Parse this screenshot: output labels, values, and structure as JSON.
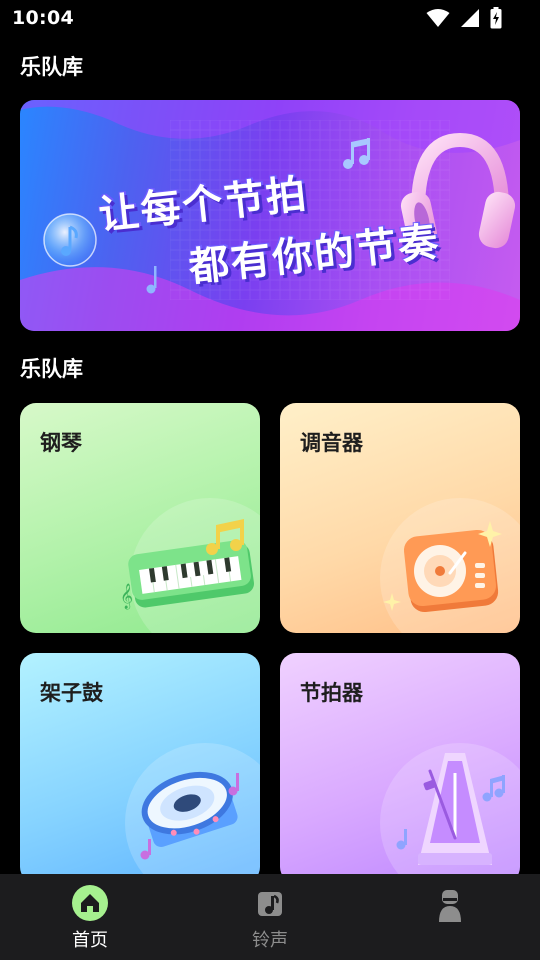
{
  "status_bar": {
    "time": "10:04",
    "icons": [
      "wifi-icon",
      "signal-icon",
      "battery-charging-icon"
    ]
  },
  "header": {
    "title": "乐队库"
  },
  "banner": {
    "line1": "让每个节拍",
    "line2": "都有你的节奏",
    "decorations": [
      "music-note-icon",
      "headphones-icon"
    ]
  },
  "section": {
    "title": "乐队库"
  },
  "cards": [
    {
      "label": "钢琴",
      "icon": "piano-icon",
      "color": "#a8f09f"
    },
    {
      "label": "调音器",
      "icon": "turntable-icon",
      "color": "#ffd3a0"
    },
    {
      "label": "架子鼓",
      "icon": "drum-icon",
      "color": "#8fd6ff"
    },
    {
      "label": "节拍器",
      "icon": "metronome-icon",
      "color": "#d7a8ff"
    }
  ],
  "bottom_nav": {
    "items": [
      {
        "label": "首页",
        "icon": "home-icon",
        "active": true
      },
      {
        "label": "铃声",
        "icon": "music-note-icon",
        "active": false
      },
      {
        "label": "",
        "icon": "profile-icon",
        "active": false
      }
    ],
    "active_color": "#a6f08f"
  }
}
